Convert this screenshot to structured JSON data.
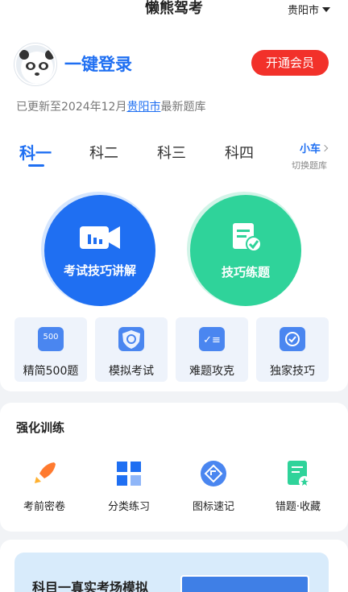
{
  "header": {
    "title": "懒熊驾考",
    "city": "贵阳市"
  },
  "account": {
    "login_label": "一键登录",
    "vip_label": "开通会员"
  },
  "update": {
    "prefix": "已更新至2024年12月",
    "city": "贵阳市",
    "suffix": "最新题库"
  },
  "subject_tabs": [
    {
      "label": "科一",
      "active": true
    },
    {
      "label": "科二",
      "active": false
    },
    {
      "label": "科三",
      "active": false
    },
    {
      "label": "科四",
      "active": false
    }
  ],
  "library_switch": {
    "vehicle": "小车",
    "hint": "切换题库"
  },
  "main_actions": [
    {
      "label": "考试技巧讲解",
      "icon": "video-camera-icon",
      "color": "#1f6ff2"
    },
    {
      "label": "技巧练题",
      "icon": "scroll-check-icon",
      "color": "#2fd39a"
    }
  ],
  "quick_tools": [
    {
      "label": "精简500题",
      "icon": "badge-500-icon",
      "badge": "500"
    },
    {
      "label": "模拟考试",
      "icon": "steering-shield-icon"
    },
    {
      "label": "难题攻克",
      "icon": "calculator-icon"
    },
    {
      "label": "独家技巧",
      "icon": "check-circle-icon"
    }
  ],
  "training": {
    "title": "强化训练",
    "items": [
      {
        "label": "考前密卷",
        "icon": "rocket-icon"
      },
      {
        "label": "分类练习",
        "icon": "grid-icon"
      },
      {
        "label": "图标速记",
        "icon": "direction-sign-icon"
      },
      {
        "label": "错题·收藏",
        "icon": "notebook-star-icon"
      }
    ]
  },
  "exam_banner": {
    "title": "科目一真实考场模拟"
  }
}
